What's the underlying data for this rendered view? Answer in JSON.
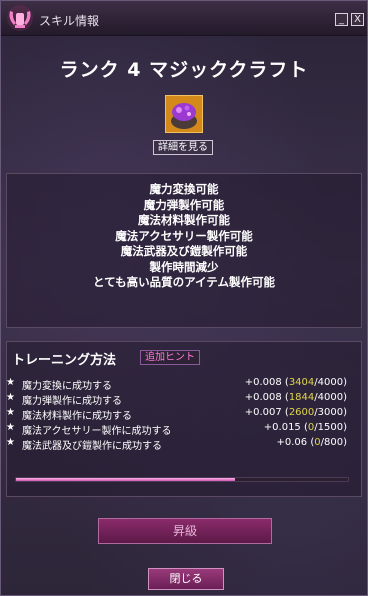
{
  "window": {
    "title": "スキル情報",
    "minimize_label": "_",
    "close_label": "X"
  },
  "skill": {
    "title": "ランク 4 マジッククラフト",
    "details_label": "詳細を見る"
  },
  "effects": [
    "魔力変換可能",
    "魔力弾製作可能",
    "魔法材料製作可能",
    "魔法アクセサリー製作可能",
    "魔法武器及び鎧製作可能",
    "製作時間減少",
    "とても高い品質のアイテム製作可能"
  ],
  "training": {
    "title": "トレーニング方法",
    "hint_label": "追加ヒント",
    "tasks": [
      {
        "star": "★",
        "name": "魔力変換に成功する",
        "reward": "+0.008",
        "current": "3404",
        "max": "4000"
      },
      {
        "star": "★",
        "name": "魔力弾製作に成功する",
        "reward": "+0.008",
        "current": "1844",
        "max": "4000"
      },
      {
        "star": "★",
        "name": "魔法材料製作に成功する",
        "reward": "+0.007",
        "current": "2600",
        "max": "3000"
      },
      {
        "star": "★",
        "name": "魔法アクセサリー製作に成功する",
        "reward": "+0.015",
        "current": "0",
        "max": "1500"
      },
      {
        "star": "★",
        "name": "魔法武器及び鎧製作に成功する",
        "reward": "+0.06",
        "current": "0",
        "max": "800"
      }
    ]
  },
  "progress": {
    "fraction": 0.66
  },
  "actions": {
    "rankup_label": "昇級",
    "close_label": "閉じる"
  },
  "colors": {
    "accent_pink": "#ff7ad8",
    "progress_yellow": "#e0d54a",
    "button_magenta": "#8a2a6a"
  },
  "icons": {
    "title_logo": "winged-hand-emblem-icon",
    "skill_icon": "magic-craft-cauldron-icon"
  }
}
